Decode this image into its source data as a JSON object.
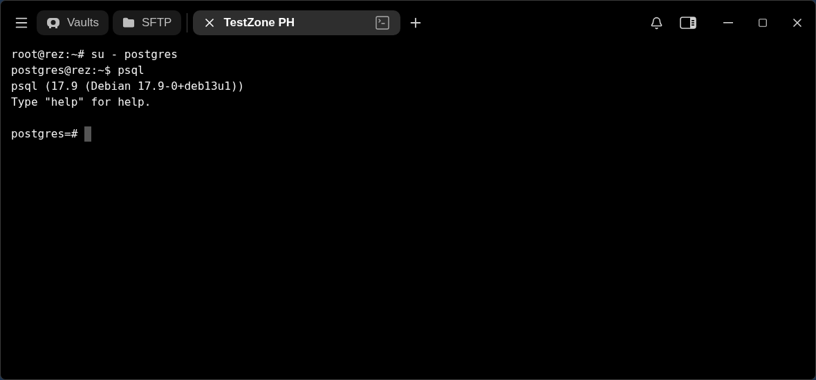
{
  "tabs": [
    {
      "label": "Vaults",
      "kind": "vault",
      "selected": false
    },
    {
      "label": "SFTP",
      "kind": "folder",
      "selected": false
    },
    {
      "label": "TestZone PH",
      "kind": "session",
      "selected": true
    }
  ],
  "terminal": {
    "lines": [
      "root@rez:~# su - postgres",
      "postgres@rez:~$ psql",
      "psql (17.9 (Debian 17.9-0+deb13u1))",
      "Type \"help\" for help."
    ],
    "prompt": "postgres=#"
  }
}
